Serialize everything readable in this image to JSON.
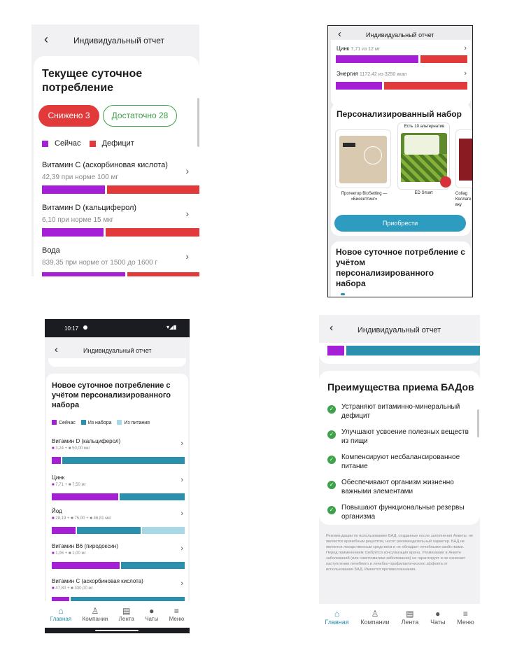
{
  "s1": {
    "back": "‹",
    "title": "Индивидуальный отчет",
    "heading": "Текущее суточное потребление",
    "filter_low": "Снижено 3",
    "filter_ok": "Достаточно 28",
    "legend_now": "Сейчас",
    "legend_deficit": "Дефицит",
    "items": [
      {
        "name": "Витамин С (аскорбиновая кислота)",
        "sub": "42,39 при норме 100 мг",
        "fill": 0.42
      },
      {
        "name": "Витамин D (кальциферол)",
        "sub": "6,10 при норме 15 мкг",
        "fill": 0.41
      },
      {
        "name": "Вода",
        "sub": "839,35 при норме от 1500 до 1600 г",
        "fill": 0.55
      }
    ]
  },
  "s2": {
    "back": "‹",
    "title": "Индивидуальный отчет",
    "row1_name": "Цинк",
    "row1_sub": "7,71 из 12 мг",
    "row1_fill": 0.64,
    "row2_name": "Энергия",
    "row2_sub": "1172,42 из 3250 ккал",
    "row2_fill": 0.36,
    "set_title": "Персонализированный набор",
    "alt_badge": "Есть 10 альтернатив",
    "products": [
      "Протектор BioSetting — «Биосеттинг»",
      "ED Smart",
      "Collag Коллаге вку"
    ],
    "buy": "Приобрести",
    "new_title": "Новое суточное потребление с учётом персонализированного набора"
  },
  "s3": {
    "time": "10:17",
    "back": "‹",
    "title": "Индивидуальный отчет",
    "heading": "Новое суточное потребление с учётом персонализированного набора",
    "legend": [
      "Сейчас",
      "Из набора",
      "Из питания"
    ],
    "items": [
      {
        "name": "Витамин D (кальциферол)",
        "sub": "3,24 + ■ 50,00 мкг",
        "segs": [
          0.07,
          0.93,
          0
        ]
      },
      {
        "name": "Цинк",
        "sub": "7,71 + ■ 7,50 мг",
        "segs": [
          0.51,
          0.49,
          0
        ]
      },
      {
        "name": "Йод",
        "sub": "28,19 + ■ 75,00 + ■ 46,81 мкг",
        "segs": [
          0.19,
          0.5,
          0.31
        ]
      },
      {
        "name": "Витамин В6 (пиродоксин)",
        "sub": "1,06 + ■ 1,00 мг",
        "segs": [
          0.52,
          0.48,
          0
        ]
      },
      {
        "name": "Витамин С (аскорбиновая кислота)",
        "sub": "47,80 + ■ 330,00 мг",
        "segs": [
          0.13,
          0.87,
          0
        ]
      }
    ],
    "nav": [
      "Главная",
      "Компании",
      "Лента",
      "Чаты",
      "Меню"
    ]
  },
  "s4": {
    "back": "‹",
    "title": "Индивидуальный отчет",
    "heading": "Преимущества приема БАДов",
    "benefits": [
      "Устраняют витаминно-минеральный дефицит",
      "Улучшают усвоение полезных веществ из пищи",
      "Компенсируют несбалансированное питание",
      "Обеспечивают организм жизненно важными элементами",
      "Повышают функциональные резервы организма"
    ],
    "disclaimer": "Рекомендации по использованию БАД, созданные после заполнения Анкеты, не являются врачебным рецептом, носят рекомендательный характер. БАД не является лекарственным средством и не обладает лечебными свойствами. Перед применением требуется консультация врача. Упоминание в Анкете заболеваний (или симптоматики заболевания) не гарантирует и не означает наступления лечебного и лечебно-профилактического эффекта от использования БАД. Имеются противопоказания.",
    "nav": [
      "Главная",
      "Компании",
      "Лента",
      "Чаты",
      "Меню"
    ]
  },
  "colors": {
    "purple": "#a51fd6",
    "red": "#e23a3a",
    "teal": "#2b8fae",
    "light_blue": "#a8d7e6",
    "green": "#3ea24a"
  }
}
